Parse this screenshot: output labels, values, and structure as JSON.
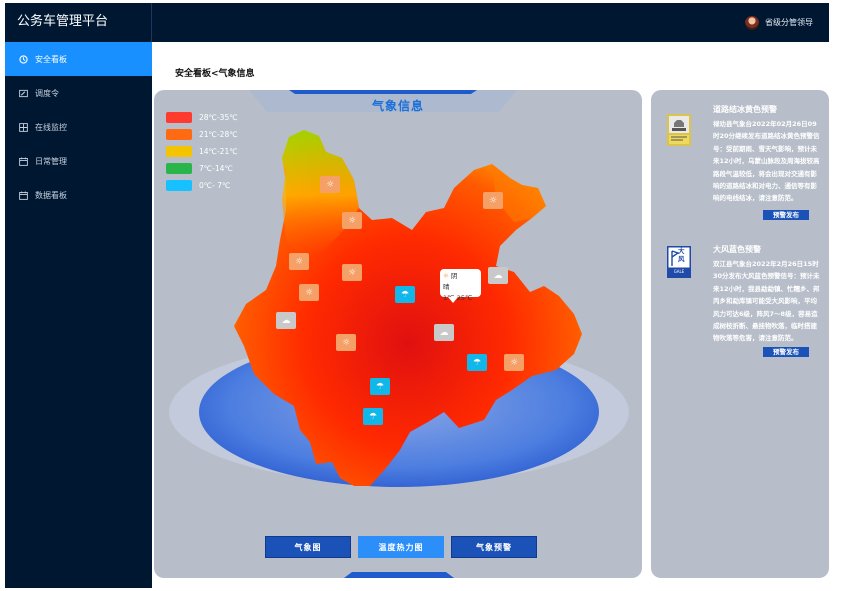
{
  "app": {
    "title": "公务车管理平台"
  },
  "user": {
    "name": "省级分管领导"
  },
  "sidebar": {
    "items": [
      {
        "label": "安全看板",
        "icon": "clock-icon"
      },
      {
        "label": "调度令",
        "icon": "edit-card-icon"
      },
      {
        "label": "在线监控",
        "icon": "grid-icon"
      },
      {
        "label": "日常管理",
        "icon": "calendar-icon"
      },
      {
        "label": "数据看板",
        "icon": "calendar-icon"
      }
    ],
    "active_index": 0
  },
  "breadcrumb": "安全看板<气象信息",
  "weather": {
    "title": "气象信息",
    "legend": [
      {
        "label": "28℃-35℃",
        "color": "#ff3b30"
      },
      {
        "label": "21℃-28℃",
        "color": "#ff6a13"
      },
      {
        "label": "14℃-21℃",
        "color": "#f5c400"
      },
      {
        "label": "7℃-14℃",
        "color": "#2ab54a"
      },
      {
        "label": "0℃- 7℃",
        "color": "#17c0ff"
      }
    ],
    "popup": {
      "condition": "阴",
      "temp": "晴1℃-25℃"
    },
    "markers": [
      "sun",
      "sun",
      "sun",
      "sun",
      "sun",
      "sun",
      "sun",
      "sun",
      "sun",
      "rain",
      "rain",
      "rain",
      "rain",
      "cloud",
      "cloud",
      "cloud"
    ],
    "tabs": [
      "气象图",
      "温度热力图",
      "气象预警"
    ],
    "active_tab": 1
  },
  "warnings": [
    {
      "title": "道路结冰黄色预警",
      "body": "禄劝县气象台2022年02月26日09时20分继续发布道路结冰黄色预警信号：受前期雨、雪天气影响，预计未来12小时，乌蒙山脉段及周海拔较高路段气温较低，将会出现对交通有影响的道路结冰和对电力、通信等有影响的电线结冰，请注意防范。",
      "button": "预警发布",
      "icon": "icy-road-warning-icon"
    },
    {
      "title": "大风蓝色预警",
      "body": "双江县气象台2022年2月26日15时30分发布大风蓝色预警信号：预计未来12小时，我县勐勐镇、忙糯乡、邦丙乡和勐库镇可能受大风影响，平均风力可达6级，阵风7～8级，容易造成树枝折断、悬挂物吹落，临时搭建物吹落等危害，请注意防范。",
      "button": "预警发布",
      "icon": "gale-warning-icon",
      "icon_text": "大风",
      "icon_subtext": "GALE"
    }
  ]
}
